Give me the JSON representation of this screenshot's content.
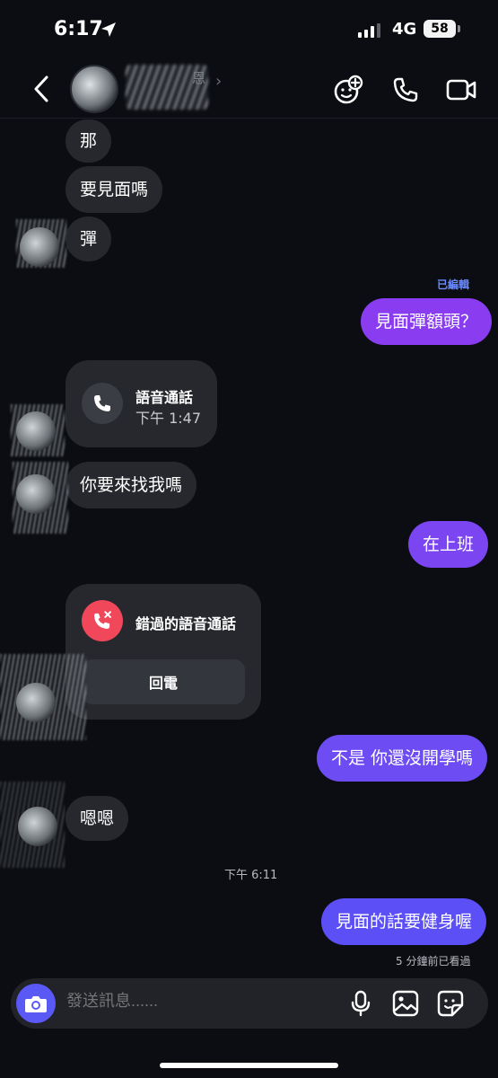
{
  "status_bar": {
    "time": "6:17",
    "network": "4G",
    "battery": "58"
  },
  "header": {
    "contact_name": "恩"
  },
  "messages": {
    "m1": "那",
    "m2": "要見面嗎",
    "m3": "彈",
    "edited_label": "已編輯",
    "m4": "見面彈額頭？",
    "voice_call_title": "語音通話",
    "voice_call_time": "下午 1:47",
    "m5": "你要來找我嗎",
    "m6": "在上班",
    "missed_call_title": "錯過的語音通話",
    "callback_label": "回電",
    "m7": "不是 你還沒開學嗎",
    "m8": "嗯嗯",
    "timestamp": "下午 6:11",
    "m9": "見面的話要健身喔",
    "seen_label": "5 分鐘前已看過"
  },
  "composer": {
    "placeholder": "發送訊息......"
  },
  "colors": {
    "background": "#0b0d12",
    "incoming": "#26282e",
    "outgoing_purple": "#8a3df0",
    "outgoing_violet": "#5b4ff5",
    "missed_red": "#f0475a",
    "accent_blue": "#6c8bff"
  }
}
